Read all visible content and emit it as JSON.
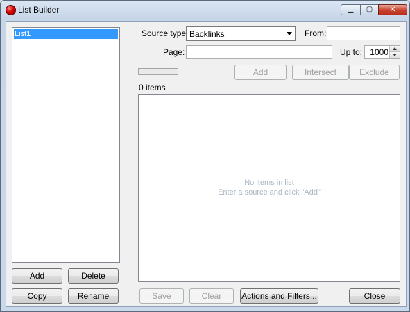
{
  "window": {
    "title": "List Builder",
    "minimize_glyph": "▁",
    "maximize_glyph": "▢",
    "close_glyph": "✕"
  },
  "lists": {
    "items": [
      "List1"
    ],
    "add_label": "Add",
    "delete_label": "Delete",
    "copy_label": "Copy",
    "rename_label": "Rename"
  },
  "source": {
    "type_label": "Source type:",
    "type_value": "Backlinks",
    "from_label": "From:",
    "from_value": "",
    "page_label": "Page:",
    "page_value": "",
    "upto_label": "Up to:",
    "upto_value": "1000"
  },
  "actions": {
    "add_label": "Add",
    "intersect_label": "Intersect",
    "exclude_label": "Exclude",
    "progress": 0
  },
  "results": {
    "count_text": "0 items",
    "empty_line1": "No items in list",
    "empty_line2": "Enter a source and click \"Add\""
  },
  "footer": {
    "save_label": "Save",
    "clear_label": "Clear",
    "actions_filters_label": "Actions and Filters...",
    "close_label": "Close"
  },
  "colors": {
    "selection": "#3399ff",
    "disabled_text": "#a0a0a0",
    "close_button": "#c8412c"
  }
}
